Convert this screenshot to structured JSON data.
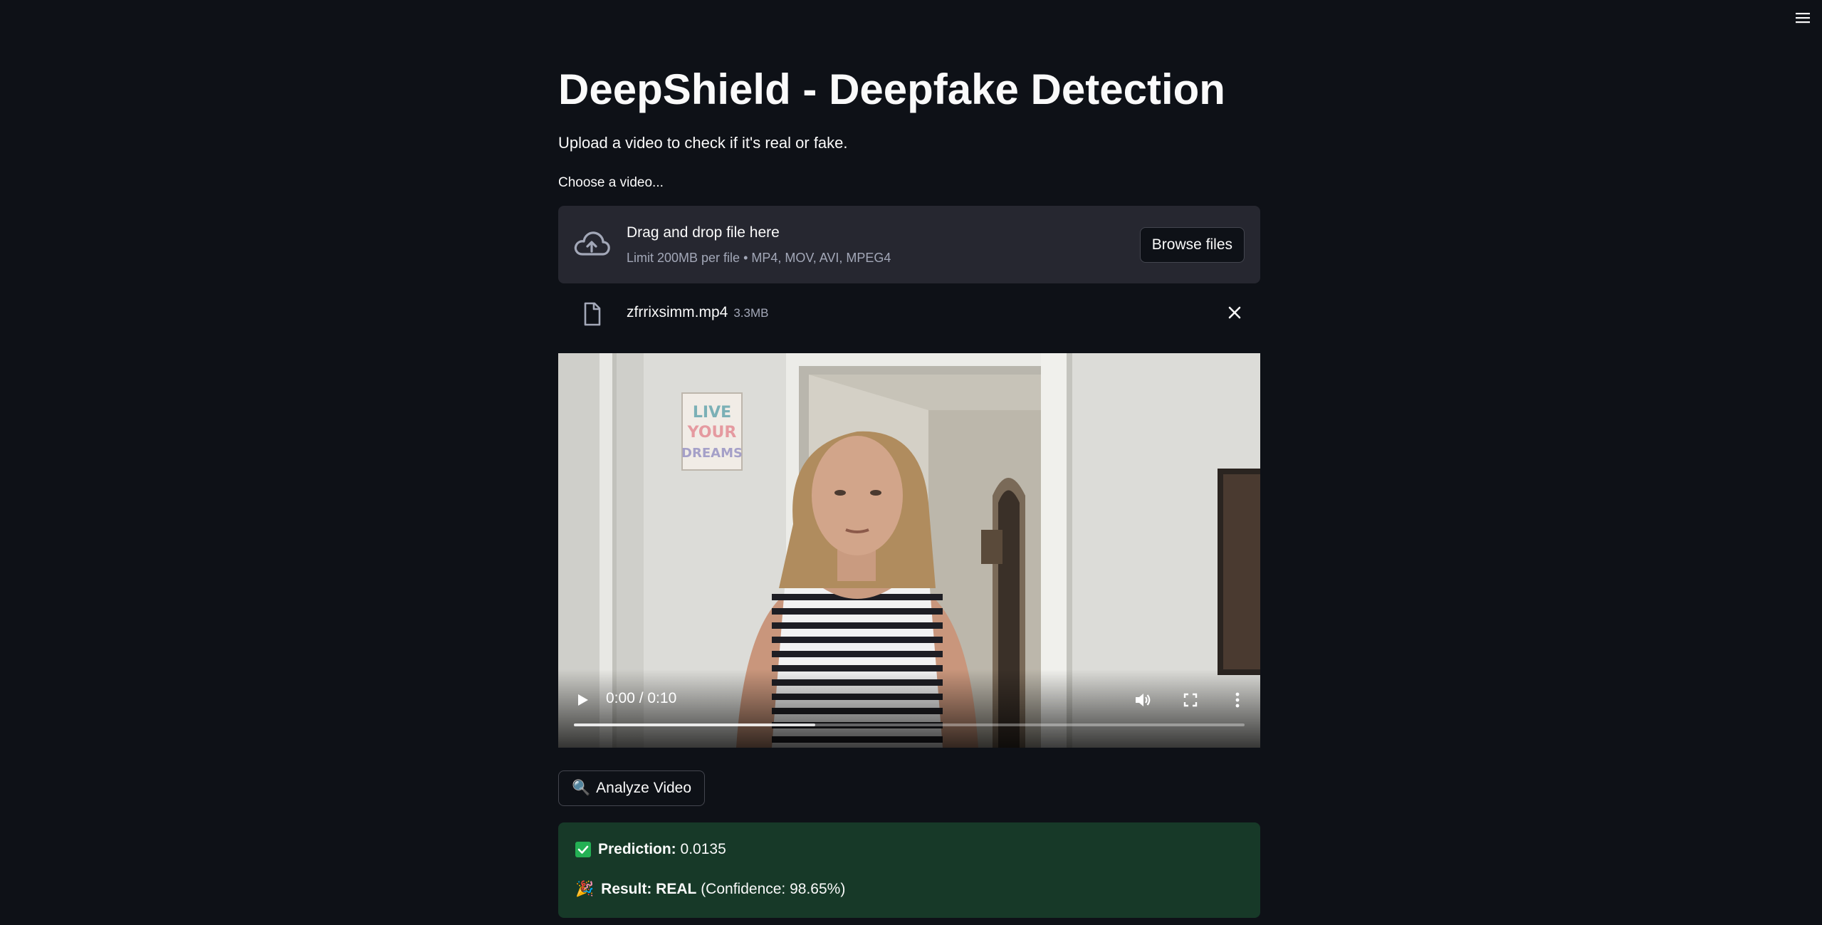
{
  "app": {
    "title": "DeepShield - Deepfake Detection",
    "subtitle": "Upload a video to check if it's real or fake."
  },
  "uploader": {
    "label": "Choose a video...",
    "drop_text": "Drag and drop file here",
    "limit_text": "Limit 200MB per file • MP4, MOV, AVI, MPEG4",
    "browse_label": "Browse files",
    "file": {
      "name": "zfrrixsimm.mp4",
      "size": "3.3MB"
    }
  },
  "video_player": {
    "time": "0:00 / 0:10",
    "buffered_fraction": 0.36,
    "poster_text": [
      "LIVE",
      "YOUR",
      "DREAMS"
    ]
  },
  "actions": {
    "analyze_icon": "🔍",
    "analyze_label": "Analyze Video"
  },
  "result": {
    "prediction_label": "Prediction:",
    "prediction_value": "0.0135",
    "result_icon": "🎉",
    "result_label": "Result: REAL",
    "confidence_text": "(Confidence: 98.65%)"
  },
  "icons": {
    "menu": "hamburger-icon",
    "upload": "cloud-upload-icon",
    "file": "file-icon",
    "remove": "close-icon",
    "play": "play-icon",
    "volume": "volume-icon",
    "fullscreen": "fullscreen-icon",
    "more": "more-vertical-icon",
    "check": "check-icon"
  },
  "colors": {
    "background": "#0e1117",
    "dropzone": "#262730",
    "success_bg": "#173928",
    "check_green": "#24b054",
    "muted_text": "#a3a8b8"
  }
}
